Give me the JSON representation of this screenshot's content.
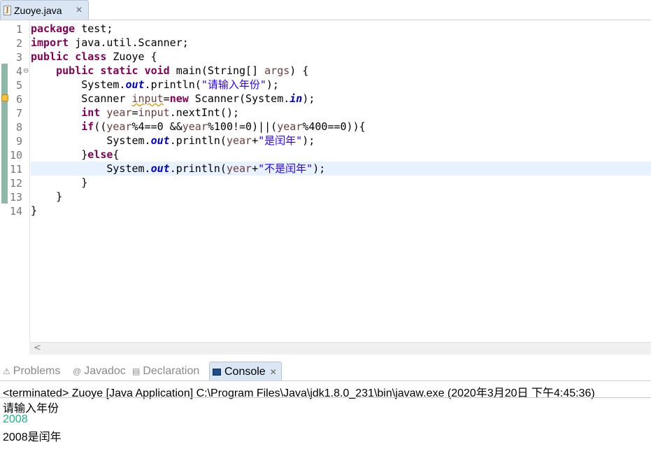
{
  "editor_tab": {
    "label": "Zuoye.java",
    "icon": "java-file-icon",
    "close": "✕"
  },
  "line_numbers": [
    "1",
    "2",
    "3",
    "4",
    "5",
    "6",
    "7",
    "8",
    "9",
    "10",
    "11",
    "12",
    "13",
    "14"
  ],
  "code": {
    "l1": {
      "kw": "package",
      "rest": " test;"
    },
    "l2": {
      "kw": "import",
      "rest": " java.util.Scanner;"
    },
    "l3": {
      "kw1": "public",
      "kw2": "class",
      "rest": " Zuoye {"
    },
    "l4": {
      "indent": "    ",
      "kw1": "public",
      "kw2": "static",
      "kw3": "void",
      "a": " main(String[] ",
      "var": "args",
      "b": ") {"
    },
    "l5": {
      "indent": "        ",
      "a": "System.",
      "fld": "out",
      "b": ".println(",
      "str": "\"请输入年份\"",
      "c": ");"
    },
    "l6": {
      "indent": "        ",
      "a": "Scanner ",
      "var": "input",
      "b": "=",
      "kw": "new",
      "c": " Scanner(System.",
      "fld": "in",
      "d": ");"
    },
    "l7": {
      "indent": "        ",
      "kw": "int",
      "sp": " ",
      "var": "year",
      "b": "=",
      "var2": "input",
      "c": ".nextInt();"
    },
    "l8": {
      "indent": "        ",
      "kw": "if",
      "a": "((",
      "v1": "year",
      "b": "%4==0 &&",
      "v2": "year",
      "c": "%100!=0)||(",
      "v3": "year",
      "d": "%400==0)){"
    },
    "l9": {
      "indent": "            ",
      "a": "System.",
      "fld": "out",
      "b": ".println(",
      "var": "year",
      "c": "+",
      "str": "\"是闰年\"",
      "d": ");"
    },
    "l10": {
      "indent": "        ",
      "a": "}",
      "kw": "else",
      "b": "{"
    },
    "l11": {
      "indent": "            ",
      "a": "System.",
      "fld": "out",
      "b": ".println(",
      "var": "year",
      "c": "+",
      "str": "\"不是闰年\"",
      "d": ");"
    },
    "l12": {
      "indent": "        ",
      "a": "}"
    },
    "l13": {
      "indent": "    ",
      "a": "}"
    },
    "l14": {
      "a": "}"
    }
  },
  "panel_tabs": {
    "problems": "Problems",
    "javadoc": "Javadoc",
    "declaration": "Declaration",
    "console": "Console",
    "close": "✕"
  },
  "console": {
    "terminated": "<terminated> Zuoye [Java Application] C:\\Program Files\\Java\\jdk1.8.0_231\\bin\\javaw.exe (2020年3月20日 下午4:45:36)",
    "line1": "请输入年份",
    "line2": "2008",
    "line3": "2008是闰年"
  },
  "colors": {
    "keyword": "#7f0055",
    "string": "#2a00ff",
    "field": "#0000c0",
    "variable": "#6a3e3e",
    "console_input": "#1ab38a",
    "current_line": "#e8f2fe"
  }
}
